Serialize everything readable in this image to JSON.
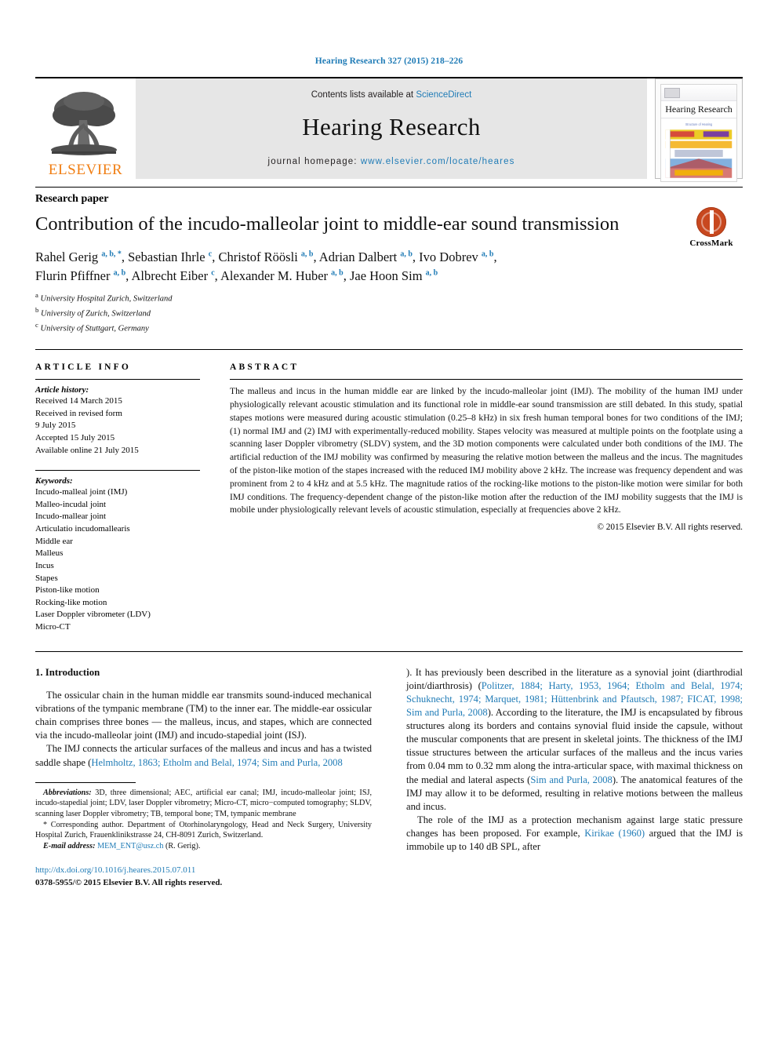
{
  "running_head": "Hearing Research 327 (2015) 218–226",
  "masthead": {
    "publisher_name": "ELSEVIER",
    "contents_prefix": "Contents lists available at ",
    "contents_link": "ScienceDirect",
    "journal_title": "Hearing Research",
    "homepage_prefix": "journal homepage: ",
    "homepage_url": "www.elsevier.com/locate/heares",
    "cover_journal_name": "Hearing Research"
  },
  "article": {
    "kind": "Research paper",
    "title": "Contribution of the incudo-malleolar joint to middle-ear sound transmission",
    "crossmark_label": "CrossMark",
    "authors_line1_html": "Rahel Gerig <sup>a, b, *</sup>, Sebastian Ihrle <sup>c</sup>, Christof Röösli <sup>a, b</sup>, Adrian Dalbert <sup>a, b</sup>, Ivo Dobrev <sup>a, b</sup>,",
    "authors_line2_html": "Flurin Pfiffner <sup>a, b</sup>, Albrecht Eiber <sup>c</sup>, Alexander M. Huber <sup>a, b</sup>, Jae Hoon Sim <sup>a, b</sup>",
    "affiliations": [
      {
        "mark": "a",
        "text": "University Hospital Zurich, Switzerland"
      },
      {
        "mark": "b",
        "text": "University of Zurich, Switzerland"
      },
      {
        "mark": "c",
        "text": "University of Stuttgart, Germany"
      }
    ]
  },
  "article_info": {
    "heading": "ARTICLE INFO",
    "history_label": "Article history:",
    "history": [
      "Received 14 March 2015",
      "Received in revised form",
      "9 July 2015",
      "Accepted 15 July 2015",
      "Available online 21 July 2015"
    ],
    "keywords_label": "Keywords:",
    "keywords": [
      "Incudo-malleal joint (IMJ)",
      "Malleo-incudal joint",
      "Incudo-mallear joint",
      "Articulatio incudomallearis",
      "Middle ear",
      "Malleus",
      "Incus",
      "Stapes",
      "Piston-like motion",
      "Rocking-like motion",
      "Laser Doppler vibrometer (LDV)",
      "Micro-CT"
    ]
  },
  "abstract": {
    "heading": "ABSTRACT",
    "text": "The malleus and incus in the human middle ear are linked by the incudo-malleolar joint (IMJ). The mobility of the human IMJ under physiologically relevant acoustic stimulation and its functional role in middle-ear sound transmission are still debated. In this study, spatial stapes motions were measured during acoustic stimulation (0.25–8 kHz) in six fresh human temporal bones for two conditions of the IMJ; (1) normal IMJ and (2) IMJ with experimentally-reduced mobility. Stapes velocity was measured at multiple points on the footplate using a scanning laser Doppler vibrometry (SLDV) system, and the 3D motion components were calculated under both conditions of the IMJ. The artificial reduction of the IMJ mobility was confirmed by measuring the relative motion between the malleus and the incus. The magnitudes of the piston-like motion of the stapes increased with the reduced IMJ mobility above 2 kHz. The increase was frequency dependent and was prominent from 2 to 4 kHz and at 5.5 kHz. The magnitude ratios of the rocking-like motions to the piston-like motion were similar for both IMJ conditions. The frequency-dependent change of the piston-like motion after the reduction of the IMJ mobility suggests that the IMJ is mobile under physiologically relevant levels of acoustic stimulation, especially at frequencies above 2 kHz.",
    "copyright": "© 2015 Elsevier B.V. All rights reserved."
  },
  "body": {
    "section_number_title": "1. Introduction",
    "para1": "The ossicular chain in the human middle ear transmits sound-induced mechanical vibrations of the tympanic membrane (TM) to the inner ear. The middle-ear ossicular chain comprises three bones — the malleus, incus, and stapes, which are connected via the incudo-malleolar joint (IMJ) and incudo-stapedial joint (ISJ).",
    "para2_pre": "The IMJ connects the articular surfaces of the malleus and incus and has a twisted saddle shape (",
    "para2_ref1": "Helmholtz, 1863; Etholm and Belal, 1974; Sim and Purla, 2008",
    "para2_mid": "). It has previously been described in the literature as a synovial joint (diarthrodial joint/diarthrosis) (",
    "para2_ref2": "Politzer, 1884; Harty, 1953, 1964; Etholm and Belal, 1974; Schuknecht, 1974; Marquet, 1981; Hüttenbrink and Pfautsch, 1987; FICAT, 1998; Sim and Purla, 2008",
    "para2_mid2": "). According to the literature, the IMJ is encapsulated by fibrous structures along its borders and contains synovial fluid inside the capsule, without the muscular components that are present in skeletal joints. The thickness of the IMJ tissue structures between the articular surfaces of the malleus and the incus varies from 0.04 mm to 0.32 mm along the intra-articular space, with maximal thickness on the medial and lateral aspects (",
    "para2_ref3": "Sim and Purla, 2008",
    "para2_end": "). The anatomical features of the IMJ may allow it to be deformed, resulting in relative motions between the malleus and incus.",
    "para3_pre": "The role of the IMJ as a protection mechanism against large static pressure changes has been proposed. For example, ",
    "para3_ref": "Kirikae (1960)",
    "para3_end": " argued that the IMJ is immobile up to 140 dB SPL, after"
  },
  "footnotes": {
    "abbreviations_label": "Abbreviations:",
    "abbreviations_text": " 3D, three dimensional; AEC, artificial ear canal; IMJ, incudo-malleolar joint; ISJ, incudo-stapedial joint; LDV, laser Doppler vibrometry; Micro-CT, micro−computed tomography; SLDV, scanning laser Doppler vibrometry; TB, temporal bone; TM, tympanic membrane",
    "corresponding_marker": "*",
    "corresponding_text": " Corresponding author. Department of Otorhinolaryngology, Head and Neck Surgery, University Hospital Zurich, Frauenklinikstrasse 24, CH-8091 Zurich, Switzerland.",
    "email_label": "E-mail address:",
    "email": "MEM_ENT@usz.ch",
    "email_suffix": " (R. Gerig).",
    "doi": "http://dx.doi.org/10.1016/j.heares.2015.07.011",
    "issn_line": "0378-5955/© 2015 Elsevier B.V. All rights reserved."
  },
  "colors": {
    "link_blue": "#1f7bb6",
    "elsevier_orange": "#f07e13",
    "band_gray": "#e6e6e6",
    "crossmark_red": "#c8481f"
  }
}
